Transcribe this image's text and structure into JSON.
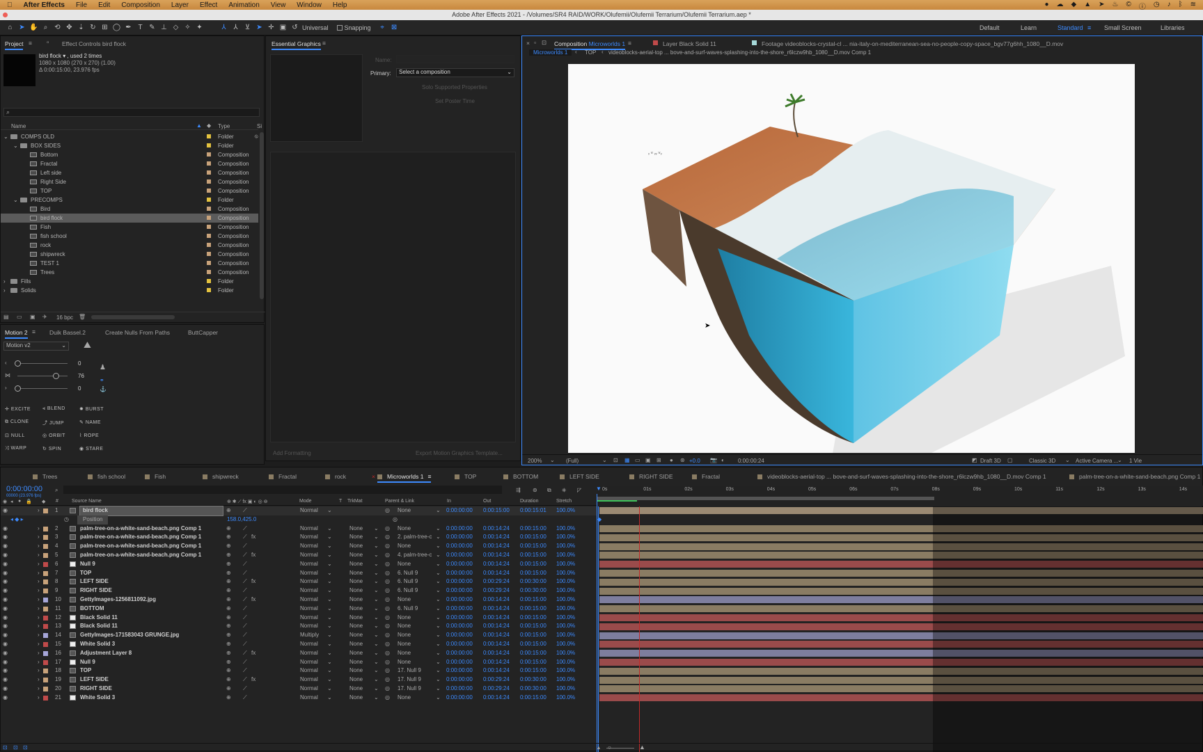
{
  "menubar": {
    "app": "After Effects",
    "items": [
      "File",
      "Edit",
      "Composition",
      "Layer",
      "Effect",
      "Animation",
      "View",
      "Window",
      "Help"
    ]
  },
  "title": "Adobe After Effects 2021 - /Volumes/SR4 RAID/WORK/Olufemii/Olufemii Terrarium/Olufemii Terrarium.aep *",
  "toolbar": {
    "universal": "Universal",
    "snapping": "Snapping"
  },
  "workspaces": [
    "Default",
    "Learn",
    "Standard",
    "Small Screen",
    "Libraries"
  ],
  "project": {
    "tab": "Project",
    "effect_controls": "Effect Controls bird flock",
    "selected_name": "bird flock ▾ , used 2 times",
    "selected_info1": "1080 x 1080  (270 x 270) (1.00)",
    "selected_info2": "Δ 0:00:15:00, 23.976 fps",
    "col_name": "Name",
    "col_type": "Type",
    "col_size": "Si",
    "items": [
      {
        "name": "COMPS OLD",
        "type": "Folder",
        "indent": 0,
        "kind": "folder",
        "arrow": "v"
      },
      {
        "name": "BOX SIDES",
        "type": "Folder",
        "indent": 1,
        "kind": "folder",
        "arrow": "v"
      },
      {
        "name": "Bottom",
        "type": "Composition",
        "indent": 2,
        "kind": "comp",
        "arrow": ""
      },
      {
        "name": "Fractal",
        "type": "Composition",
        "indent": 2,
        "kind": "comp",
        "arrow": ""
      },
      {
        "name": "Left side",
        "type": "Composition",
        "indent": 2,
        "kind": "comp",
        "arrow": ""
      },
      {
        "name": "Right Side",
        "type": "Composition",
        "indent": 2,
        "kind": "comp",
        "arrow": ""
      },
      {
        "name": "TOP",
        "type": "Composition",
        "indent": 2,
        "kind": "comp",
        "arrow": ""
      },
      {
        "name": "PRECOMPS",
        "type": "Folder",
        "indent": 1,
        "kind": "folder",
        "arrow": "v"
      },
      {
        "name": "Bird",
        "type": "Composition",
        "indent": 2,
        "kind": "comp",
        "arrow": ""
      },
      {
        "name": "bird flock",
        "type": "Composition",
        "indent": 2,
        "kind": "comp",
        "arrow": "",
        "selected": true
      },
      {
        "name": "Fish",
        "type": "Composition",
        "indent": 2,
        "kind": "comp",
        "arrow": ""
      },
      {
        "name": "fish school",
        "type": "Composition",
        "indent": 2,
        "kind": "comp",
        "arrow": ""
      },
      {
        "name": "rock",
        "type": "Composition",
        "indent": 2,
        "kind": "comp",
        "arrow": ""
      },
      {
        "name": "shipwreck",
        "type": "Composition",
        "indent": 2,
        "kind": "comp",
        "arrow": ""
      },
      {
        "name": "TEST 1",
        "type": "Composition",
        "indent": 2,
        "kind": "comp",
        "arrow": ""
      },
      {
        "name": "Trees",
        "type": "Composition",
        "indent": 2,
        "kind": "comp",
        "arrow": ""
      },
      {
        "name": "Fills",
        "type": "Folder",
        "indent": 0,
        "kind": "folder",
        "arrow": ">"
      },
      {
        "name": "Solids",
        "type": "Folder",
        "indent": 0,
        "kind": "folder",
        "arrow": ">"
      }
    ],
    "bpc": "16 bpc"
  },
  "essential": {
    "tab": "Essential Graphics",
    "name_label": "Name:",
    "primary_label": "Primary:",
    "primary_value": "Select a composition",
    "solo": "Solo Supported Properties",
    "poster": "Set Poster Time",
    "add_formatting": "Add Formatting",
    "export": "Export Motion Graphics Template..."
  },
  "motion": {
    "tabs": [
      "Motion 2",
      "Duik Bassel.2",
      "Create Nulls From Paths",
      "ButtCapper"
    ],
    "version": "Motion v2",
    "v1": "0",
    "v2": "76",
    "v3": "0",
    "buttons": [
      "EXCITE",
      "BLEND",
      "BURST",
      "CLONE",
      "JUMP",
      "NAME",
      "NULL",
      "ORBIT",
      "ROPE",
      "WARP",
      "SPIN",
      "STARE"
    ]
  },
  "comp": {
    "tab_comp": "Composition",
    "tab_comp_name": "Microworlds 1",
    "tab_layer": "Layer Black Solid 11",
    "tab_footage": "Footage videoblocks-crystal-cl ... nia-italy-on-mediterranean-sea-no-people-copy-space_bgv77g6hh_1080__D.mov",
    "crumbs": [
      "Microworlds 1",
      "TOP",
      "videoblocks-aerial-top ... bove-and-surf-waves-splashing-into-the-shore_r6lczw9hb_1080__D.mov Comp 1"
    ],
    "zoom": "200%",
    "resolution": "(Full)",
    "exposure": "+0.0",
    "time": "0:00:00:24",
    "draft": "Draft 3D",
    "renderer": "Classic 3D",
    "camera": "Active Camera ...",
    "views": "1 Vie"
  },
  "timeline": {
    "tabs": [
      "Trees",
      "fish school",
      "Fish",
      "shipwreck",
      "Fractal",
      "rock",
      "Microworlds 1",
      "TOP",
      "BOTTOM",
      "LEFT SIDE",
      "RIGHT SIDE",
      "Fractal",
      "videoblocks-aerial-top ... bove-and-surf-waves-splashing-into-the-shore_r6lczw9hb_1080__D.mov Comp 1",
      "palm-tree-on-a-white-sand-beach.png Comp 1"
    ],
    "active_tab": "Microworlds 1",
    "timecode": "0:00:00:00",
    "timecode_sub": "00000 (23.976 fps)",
    "headers": {
      "num": "#",
      "source": "Source Name",
      "mode": "Mode",
      "t": "T",
      "trkmat": "TrkMat",
      "parent": "Parent & Link",
      "in": "In",
      "out": "Out",
      "duration": "Duration",
      "stretch": "Stretch"
    },
    "ruler": [
      "0s",
      "01s",
      "02s",
      "03s",
      "04s",
      "05s",
      "06s",
      "07s",
      "08s",
      "09s",
      "10s",
      "11s",
      "12s",
      "13s",
      "14s"
    ],
    "position_label": "Position",
    "position_value": "158.0,425.0",
    "layers": [
      {
        "n": "1",
        "name": "bird flock",
        "color": "#c8a27a",
        "mode": "Normal",
        "trk": "",
        "parent": "None",
        "in": "0:00:00:00",
        "out": "0:00:15:00",
        "dur": "0:00:15:01",
        "st": "100.0%",
        "fx": "",
        "bar": "#9b8a73"
      },
      {
        "n": "2",
        "name": "palm-tree-on-a-white-sand-beach.png Comp 1",
        "color": "#c8a27a",
        "mode": "Normal",
        "trk": "None",
        "parent": "None",
        "in": "0:00:00:00",
        "out": "0:00:14:24",
        "dur": "0:00:15:00",
        "st": "100.0%",
        "fx": "",
        "bar": "#8a7c63"
      },
      {
        "n": "3",
        "name": "palm-tree-on-a-white-sand-beach.png Comp 1",
        "color": "#c8a27a",
        "mode": "Normal",
        "trk": "None",
        "parent": "2. palm-tree-c",
        "in": "0:00:00:00",
        "out": "0:00:14:24",
        "dur": "0:00:15:00",
        "st": "100.0%",
        "fx": "fx",
        "bar": "#8a7c63"
      },
      {
        "n": "4",
        "name": "palm-tree-on-a-white-sand-beach.png Comp 1",
        "color": "#c8a27a",
        "mode": "Normal",
        "trk": "None",
        "parent": "None",
        "in": "0:00:00:00",
        "out": "0:00:14:24",
        "dur": "0:00:15:00",
        "st": "100.0%",
        "fx": "",
        "bar": "#8a7c63"
      },
      {
        "n": "5",
        "name": "palm-tree-on-a-white-sand-beach.png Comp 1",
        "color": "#c8a27a",
        "mode": "Normal",
        "trk": "None",
        "parent": "4. palm-tree-c",
        "in": "0:00:00:00",
        "out": "0:00:14:24",
        "dur": "0:00:15:00",
        "st": "100.0%",
        "fx": "fx",
        "bar": "#8a7c63"
      },
      {
        "n": "6",
        "name": "Null 9",
        "color": "#c04a4a",
        "mode": "Normal",
        "trk": "None",
        "parent": "None",
        "in": "0:00:00:00",
        "out": "0:00:14:24",
        "dur": "0:00:15:00",
        "st": "100.0%",
        "fx": "",
        "bar": "#9a4b4b"
      },
      {
        "n": "7",
        "name": "TOP",
        "color": "#c8a27a",
        "mode": "Normal",
        "trk": "None",
        "parent": "6. Null 9",
        "in": "0:00:00:00",
        "out": "0:00:14:24",
        "dur": "0:00:15:00",
        "st": "100.0%",
        "fx": "",
        "bar": "#8a7c63"
      },
      {
        "n": "8",
        "name": "LEFT SIDE",
        "color": "#c8a27a",
        "mode": "Normal",
        "trk": "None",
        "parent": "6. Null 9",
        "in": "0:00:00:00",
        "out": "0:00:29:24",
        "dur": "0:00:30:00",
        "st": "100.0%",
        "fx": "fx",
        "bar": "#8a7c63"
      },
      {
        "n": "9",
        "name": "RIGHT SIDE",
        "color": "#c8a27a",
        "mode": "Normal",
        "trk": "None",
        "parent": "6. Null 9",
        "in": "0:00:00:00",
        "out": "0:00:29:24",
        "dur": "0:00:30:00",
        "st": "100.0%",
        "fx": "",
        "bar": "#8a7c63"
      },
      {
        "n": "10",
        "name": "GettyImages-1256811092.jpg",
        "color": "#a6a6d8",
        "mode": "Normal",
        "trk": "None",
        "parent": "None",
        "in": "0:00:00:00",
        "out": "0:00:14:24",
        "dur": "0:00:15:00",
        "st": "100.0%",
        "fx": "fx",
        "bar": "#7e7e9e"
      },
      {
        "n": "11",
        "name": "BOTTOM",
        "color": "#c8a27a",
        "mode": "Normal",
        "trk": "None",
        "parent": "6. Null 9",
        "in": "0:00:00:00",
        "out": "0:00:14:24",
        "dur": "0:00:15:00",
        "st": "100.0%",
        "fx": "",
        "bar": "#8a7c63"
      },
      {
        "n": "12",
        "name": "Black Solid 11",
        "color": "#c04a4a",
        "mode": "Normal",
        "trk": "None",
        "parent": "None",
        "in": "0:00:00:00",
        "out": "0:00:14:24",
        "dur": "0:00:15:00",
        "st": "100.0%",
        "fx": "",
        "bar": "#9a4b4b"
      },
      {
        "n": "13",
        "name": "Black Solid 11",
        "color": "#c04a4a",
        "mode": "Normal",
        "trk": "None",
        "parent": "None",
        "in": "0:00:00:00",
        "out": "0:00:14:24",
        "dur": "0:00:15:00",
        "st": "100.0%",
        "fx": "",
        "bar": "#9a4b4b"
      },
      {
        "n": "14",
        "name": "GettyImages-171583043 GRUNGE.jpg",
        "color": "#a6a6d8",
        "mode": "Multiply",
        "trk": "None",
        "parent": "None",
        "in": "0:00:00:00",
        "out": "0:00:14:24",
        "dur": "0:00:15:00",
        "st": "100.0%",
        "fx": "",
        "bar": "#7e7e9e"
      },
      {
        "n": "15",
        "name": "White Solid 3",
        "color": "#c04a4a",
        "mode": "Normal",
        "trk": "None",
        "parent": "None",
        "in": "0:00:00:00",
        "out": "0:00:14:24",
        "dur": "0:00:15:00",
        "st": "100.0%",
        "fx": "",
        "bar": "#9a4b4b"
      },
      {
        "n": "16",
        "name": "Adjustment Layer 8",
        "color": "#a6a6d8",
        "mode": "Normal",
        "trk": "None",
        "parent": "None",
        "in": "0:00:00:00",
        "out": "0:00:14:24",
        "dur": "0:00:15:00",
        "st": "100.0%",
        "fx": "fx",
        "bar": "#7e7e9e"
      },
      {
        "n": "17",
        "name": "Null 9",
        "color": "#c04a4a",
        "mode": "Normal",
        "trk": "None",
        "parent": "None",
        "in": "0:00:00:00",
        "out": "0:00:14:24",
        "dur": "0:00:15:00",
        "st": "100.0%",
        "fx": "",
        "bar": "#9a4b4b"
      },
      {
        "n": "18",
        "name": "TOP",
        "color": "#c8a27a",
        "mode": "Normal",
        "trk": "None",
        "parent": "17. Null 9",
        "in": "0:00:00:00",
        "out": "0:00:14:24",
        "dur": "0:00:15:00",
        "st": "100.0%",
        "fx": "",
        "bar": "#8a7c63"
      },
      {
        "n": "19",
        "name": "LEFT SIDE",
        "color": "#c8a27a",
        "mode": "Normal",
        "trk": "None",
        "parent": "17. Null 9",
        "in": "0:00:00:00",
        "out": "0:00:29:24",
        "dur": "0:00:30:00",
        "st": "100.0%",
        "fx": "fx",
        "bar": "#8a7c63"
      },
      {
        "n": "20",
        "name": "RIGHT SIDE",
        "color": "#c8a27a",
        "mode": "Normal",
        "trk": "None",
        "parent": "17. Null 9",
        "in": "0:00:00:00",
        "out": "0:00:29:24",
        "dur": "0:00:30:00",
        "st": "100.0%",
        "fx": "",
        "bar": "#8a7c63"
      },
      {
        "n": "21",
        "name": "White Solid 3",
        "color": "#c04a4a",
        "mode": "Normal",
        "trk": "None",
        "parent": "None",
        "in": "0:00:00:00",
        "out": "0:00:14:24",
        "dur": "0:00:15:00",
        "st": "100.0%",
        "fx": "",
        "bar": "#9a4b4b"
      }
    ]
  },
  "colors": {
    "accent": "#3d8bff",
    "menubar": "#d39a4f",
    "playhead": "#c22a2a"
  }
}
